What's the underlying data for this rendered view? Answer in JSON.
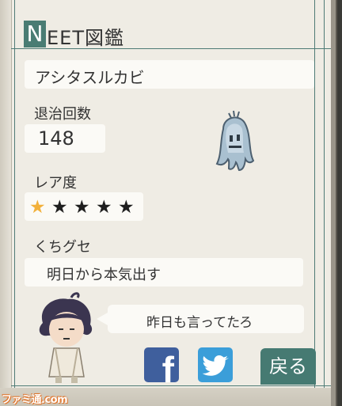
{
  "title": {
    "badge": "N",
    "rest": "EET図鑑"
  },
  "name": "アシタスルカビ",
  "kills": {
    "label": "退治回数",
    "value": "148"
  },
  "rarity": {
    "label": "レア度",
    "stars_total": 5,
    "stars_highlighted": 1
  },
  "habit": {
    "label": "くちグセ",
    "value": "明日から本気出す"
  },
  "speech": "昨日も言ってたろ",
  "share": {
    "facebook_icon": "facebook-icon",
    "twitter_icon": "twitter-icon"
  },
  "back_label": "戻る",
  "watermark": "ファミ通.com",
  "colors": {
    "accent": "#497c73",
    "paper": "#efece4",
    "facebook": "#3f5f9d",
    "twitter": "#3b9ed9",
    "star_highlight": "#f2b03a"
  }
}
